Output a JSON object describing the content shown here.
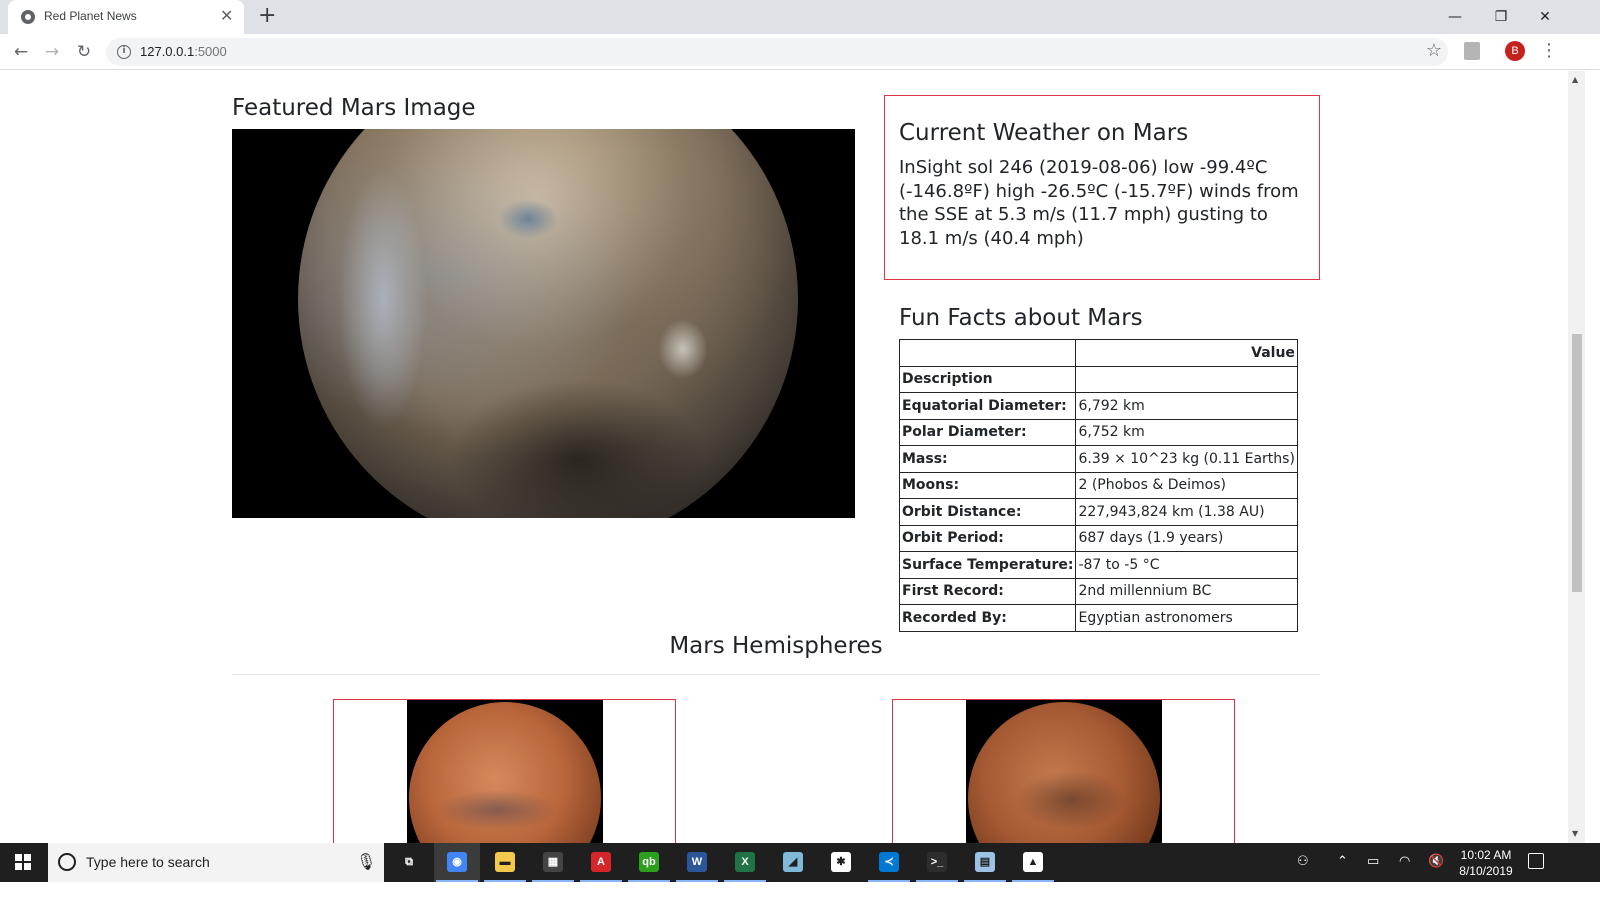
{
  "browser": {
    "tab_title": "Red Planet News",
    "tab_close": "✕",
    "new_tab": "+",
    "url_host": "127.0.0.1",
    "url_port": ":5000",
    "avatar_letter": "B",
    "window_controls": [
      "—",
      "❐",
      "✕"
    ]
  },
  "page": {
    "featured_heading": "Featured Mars Image",
    "weather_heading": "Current Weather on Mars",
    "weather_text": "InSight sol 246 (2019-08-06) low -99.4ºC (-146.8ºF) high -26.5ºC (-15.7ºF) winds from the SSE at 5.3 m/s (11.7 mph) gusting to 18.1 m/s (40.4 mph)",
    "facts_heading": "Fun Facts about Mars",
    "facts_table": {
      "header_value": "Value",
      "rows": [
        {
          "label": "Description",
          "value": ""
        },
        {
          "label": "Equatorial Diameter:",
          "value": "6,792 km"
        },
        {
          "label": "Polar Diameter:",
          "value": "6,752 km"
        },
        {
          "label": "Mass:",
          "value": "6.39 × 10^23 kg (0.11 Earths)"
        },
        {
          "label": "Moons:",
          "value": "2 (Phobos & Deimos)"
        },
        {
          "label": "Orbit Distance:",
          "value": "227,943,824 km (1.38 AU)"
        },
        {
          "label": "Orbit Period:",
          "value": "687 days (1.9 years)"
        },
        {
          "label": "Surface Temperature:",
          "value": "-87 to -5 °C"
        },
        {
          "label": "First Record:",
          "value": "2nd millennium BC"
        },
        {
          "label": "Recorded By:",
          "value": "Egyptian astronomers"
        }
      ]
    },
    "hemispheres_heading": "Mars Hemispheres"
  },
  "taskbar": {
    "search_placeholder": "Type here to search",
    "apps": [
      {
        "name": "task-view",
        "color": "#1f1f1f",
        "glyph": "⧉"
      },
      {
        "name": "chrome",
        "color": "#4285f4",
        "glyph": "◉"
      },
      {
        "name": "file-explorer",
        "color": "#f2c94c",
        "glyph": "▬"
      },
      {
        "name": "calculator",
        "color": "#444444",
        "glyph": "▦"
      },
      {
        "name": "acrobat",
        "color": "#d7262a",
        "glyph": "A"
      },
      {
        "name": "quickbooks",
        "color": "#2ca01c",
        "glyph": "qb"
      },
      {
        "name": "word",
        "color": "#2b579a",
        "glyph": "W"
      },
      {
        "name": "excel",
        "color": "#217346",
        "glyph": "X"
      },
      {
        "name": "notes",
        "color": "#7fb8d9",
        "glyph": "◢"
      },
      {
        "name": "slack",
        "color": "#ffffff",
        "glyph": "✱"
      },
      {
        "name": "vscode",
        "color": "#0078d4",
        "glyph": "≺"
      },
      {
        "name": "terminal",
        "color": "#2d2d2d",
        "glyph": ">_"
      },
      {
        "name": "notepad",
        "color": "#9cc3e6",
        "glyph": "▤"
      },
      {
        "name": "photos",
        "color": "#ffffff",
        "glyph": "▲"
      }
    ],
    "clock_time": "10:02 AM",
    "clock_date": "8/10/2019"
  }
}
